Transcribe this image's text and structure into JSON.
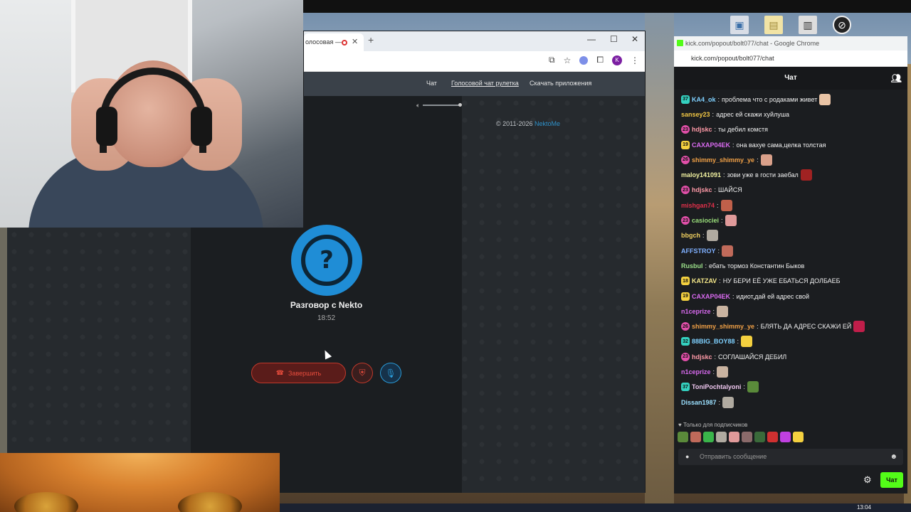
{
  "browser": {
    "tab_title": "олосовая —",
    "nav": {
      "chat": "Чат",
      "voice": "Голосовой чат рулетка",
      "apps": "Скачать приложения"
    },
    "copyright_text": "© 2011-2026",
    "copyright_link": "NektoMe"
  },
  "call": {
    "title": "Разговор с Nekto",
    "timer": "18:52",
    "end_label": "Завершить",
    "avatar_glyph": "?"
  },
  "chat": {
    "window_title": "kick.com/popout/bolt077/chat - Google Chrome",
    "url": "kick.com/popout/bolt077/chat",
    "header": "Чат",
    "messages": [
      {
        "badge": "37",
        "badge_color": "#34d1c0",
        "user": "KA4_ok",
        "user_color": "#7fd1ff",
        "text": "проблема что с родаками живет",
        "emote_color": "#e9c3a5"
      },
      {
        "badge": "",
        "badge_color": "",
        "user": "sansey23",
        "user_color": "#f2c744",
        "text": "адрес ей скажи хуйлуша",
        "emote_color": ""
      },
      {
        "badge": "23",
        "badge_color": "#e04fa8",
        "user": "hdjskc",
        "user_color": "#ff9aa8",
        "text": "ты дебил комстя",
        "emote_color": ""
      },
      {
        "badge": "19",
        "badge_color": "#f4d03f",
        "user": "CAXAP04EK",
        "user_color": "#d96af0",
        "text": "она вахуе сама,целка толстая",
        "emote_color": ""
      },
      {
        "badge": "26",
        "badge_color": "#e04fa8",
        "user": "shimmy_shimmy_ye",
        "user_color": "#f0a046",
        "text": "",
        "emote_color": "#d9a08a"
      },
      {
        "badge": "",
        "badge_color": "",
        "user": "maloy141091",
        "user_color": "#f2f2a0",
        "text": "зови уже в гости заебал",
        "emote_color": "#a02222"
      },
      {
        "badge": "23",
        "badge_color": "#e04fa8",
        "user": "hdjskc",
        "user_color": "#ff9aa8",
        "text": "ШАЙСЯ",
        "emote_color": ""
      },
      {
        "badge": "",
        "badge_color": "",
        "user": "mishgan74",
        "user_color": "#e0304a",
        "text": "",
        "emote_color": "#c0604a"
      },
      {
        "badge": "23",
        "badge_color": "#e04fa8",
        "user": "casiociei",
        "user_color": "#9adf7a",
        "text": "",
        "emote_color": "#e09a9a"
      },
      {
        "badge": "",
        "badge_color": "",
        "user": "bbgch",
        "user_color": "#f0d060",
        "text": "",
        "emote_color": "#b0aaa0"
      },
      {
        "badge": "",
        "badge_color": "",
        "user": "AFFSTROY",
        "user_color": "#7fb0ff",
        "text": "",
        "emote_color": "#c06a5a"
      },
      {
        "badge": "",
        "badge_color": "",
        "user": "Rusbul",
        "user_color": "#9be08a",
        "text": "ебать тормоз Константин Быков",
        "emote_color": ""
      },
      {
        "badge": "18",
        "badge_color": "#f4d03f",
        "user": "KATZAV",
        "user_color": "#f5e88a",
        "text": "НУ БЕРИ ЕЁ УЖЕ ЕБАТЬСЯ ДОЛБАЕБ",
        "emote_color": ""
      },
      {
        "badge": "19",
        "badge_color": "#f4d03f",
        "user": "CAXAP04EK",
        "user_color": "#d96af0",
        "text": "идиот,дай ей адрес свой",
        "emote_color": ""
      },
      {
        "badge": "",
        "badge_color": "",
        "user": "n1ceprize",
        "user_color": "#d96af0",
        "text": "",
        "emote_color": "#c9b3a0"
      },
      {
        "badge": "26",
        "badge_color": "#e04fa8",
        "user": "shimmy_shimmy_ye",
        "user_color": "#f0a046",
        "text": "БЛЯТЬ ДА АДРЕС СКАЖИ ЕЙ",
        "emote_color": "#c01e4a"
      },
      {
        "badge": "32",
        "badge_color": "#34d1c0",
        "user": "88BIG_BOY88",
        "user_color": "#7fd1ff",
        "text": "",
        "emote_color": "#f4d03f"
      },
      {
        "badge": "23",
        "badge_color": "#e04fa8",
        "user": "hdjskc",
        "user_color": "#ff9aa8",
        "text": "СОГЛАШАЙСЯ ДЕБИЛ",
        "emote_color": ""
      },
      {
        "badge": "",
        "badge_color": "",
        "user": "n1ceprize",
        "user_color": "#d96af0",
        "text": "",
        "emote_color": "#c9b3a0"
      },
      {
        "badge": "37",
        "badge_color": "#34d1c0",
        "user": "ToniPochtalyoni",
        "user_color": "#f0c8f0",
        "text": "",
        "emote_color": "#5a8a3a"
      },
      {
        "badge": "",
        "badge_color": "",
        "user": "Dissan1987",
        "user_color": "#9be0ff",
        "text": "",
        "emote_color": "#b0aaa0"
      }
    ],
    "subs_only": "Только для подписчиков",
    "input_placeholder": "Отправить сообщение",
    "send_label": "Чат"
  },
  "taskbar": {
    "time": "13:04"
  }
}
